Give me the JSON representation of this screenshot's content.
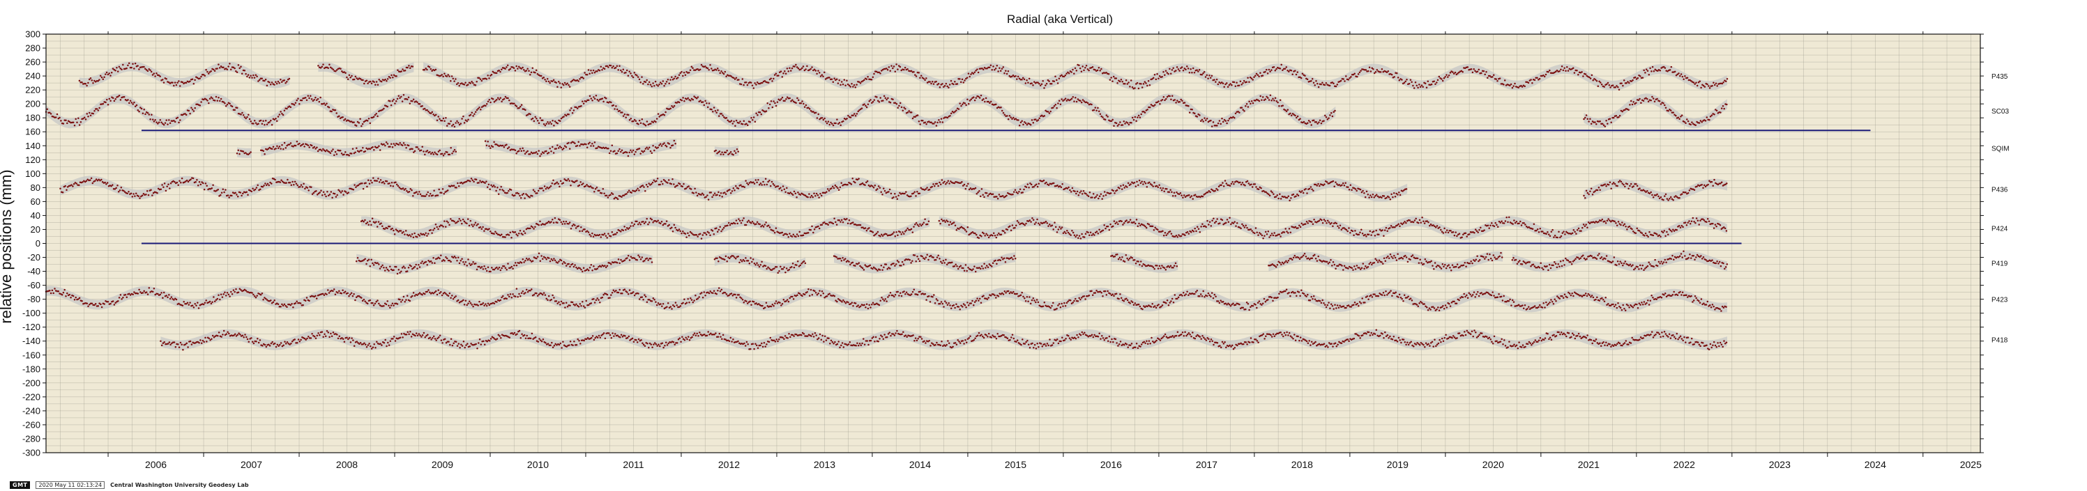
{
  "colors": {
    "plot_bg": "#efe9d5",
    "grid": "#8a8a7e",
    "point": "#7b1010",
    "band": "#c4c4c4",
    "reference_line": "#1a1a78"
  },
  "footer": {
    "badge": "GMT",
    "timestamp": "2020 May 11 02:13:24",
    "lab": "Central Washington University Geodesy Lab"
  },
  "chart_data": {
    "type": "scatter",
    "title": "Radial (aka Vertical)",
    "xlabel": "",
    "ylabel": "relative positions (mm)",
    "xlim": [
      2005.35,
      2025.6
    ],
    "ylim": [
      -300,
      300
    ],
    "x_ticks": [
      2006,
      2007,
      2008,
      2009,
      2010,
      2011,
      2012,
      2013,
      2014,
      2015,
      2016,
      2017,
      2018,
      2019,
      2020,
      2021,
      2022,
      2023,
      2024,
      2025
    ],
    "y_ticks": [
      300,
      280,
      260,
      240,
      220,
      200,
      180,
      160,
      140,
      120,
      100,
      80,
      60,
      40,
      20,
      0,
      -20,
      -40,
      -60,
      -80,
      -100,
      -120,
      -140,
      -160,
      -180,
      -200,
      -220,
      -240,
      -260,
      -280,
      -300
    ],
    "grid": true,
    "reference_lines": [
      {
        "y": 162,
        "x_start": 2006.35,
        "x_end": 2024.45
      },
      {
        "y": 0,
        "x_start": 2006.35,
        "x_end": 2023.1
      }
    ],
    "series": [
      {
        "name": "P435",
        "offset": 240,
        "amplitude": 12,
        "segments": [
          [
            2005.7,
            2007.9
          ],
          [
            2008.2,
            2009.2
          ],
          [
            2009.3,
            2022.95
          ]
        ]
      },
      {
        "name": "SC03",
        "offset": 190,
        "amplitude": 18,
        "segments": [
          [
            2005.35,
            2018.85
          ],
          [
            2021.45,
            2022.95
          ]
        ]
      },
      {
        "name": "SQIM",
        "offset": 137,
        "amplitude": 6,
        "segments": [
          [
            2007.35,
            2007.5
          ],
          [
            2007.6,
            2009.65
          ],
          [
            2009.95,
            2011.95
          ],
          [
            2012.35,
            2012.6
          ]
        ]
      },
      {
        "name": "P436",
        "offset": 78,
        "amplitude": 10,
        "segments": [
          [
            2005.5,
            2019.6
          ],
          [
            2021.45,
            2022.95
          ]
        ]
      },
      {
        "name": "P424",
        "offset": 22,
        "amplitude": 10,
        "segments": [
          [
            2008.65,
            2014.6
          ],
          [
            2014.7,
            2022.95
          ]
        ]
      },
      {
        "name": "P419",
        "offset": -28,
        "amplitude": 8,
        "segments": [
          [
            2008.6,
            2011.7
          ],
          [
            2012.35,
            2013.3
          ],
          [
            2013.6,
            2015.5
          ],
          [
            2016.5,
            2017.2
          ],
          [
            2018.15,
            2020.6
          ],
          [
            2020.7,
            2022.95
          ]
        ]
      },
      {
        "name": "P423",
        "offset": -80,
        "amplitude": 10,
        "segments": [
          [
            2005.35,
            2022.95
          ]
        ]
      },
      {
        "name": "P418",
        "offset": -138,
        "amplitude": 8,
        "segments": [
          [
            2006.55,
            2022.95
          ]
        ]
      }
    ]
  }
}
